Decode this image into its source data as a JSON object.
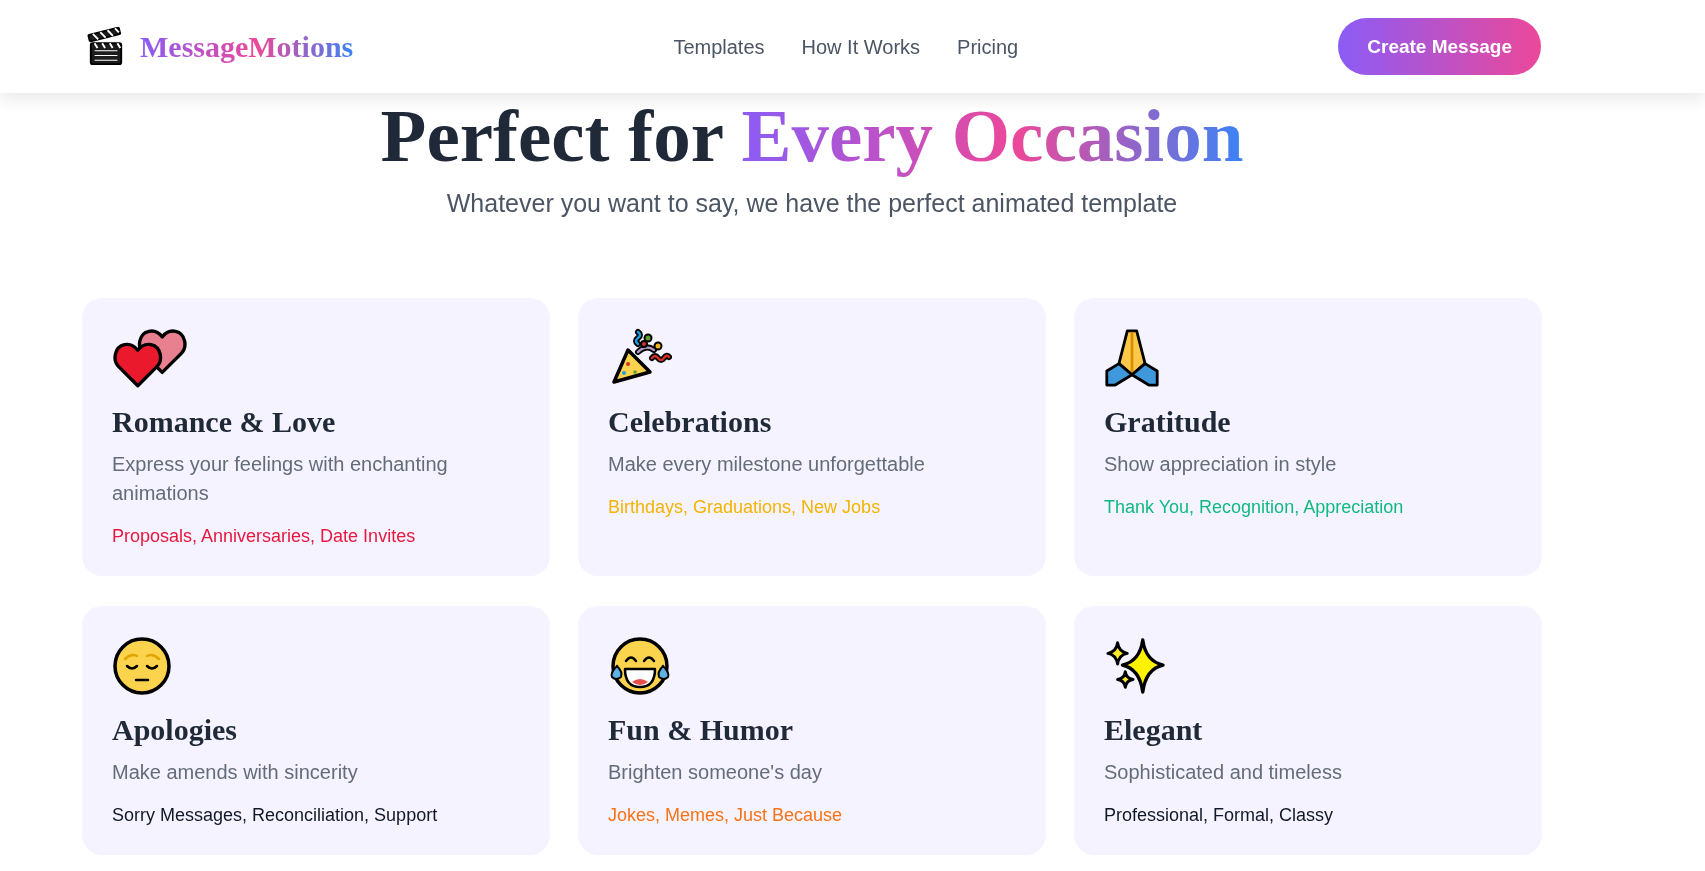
{
  "header": {
    "logo": "MessageMotions",
    "nav": [
      "Templates",
      "How It Works",
      "Pricing"
    ],
    "cta": "Create Message"
  },
  "hero": {
    "title": "Perfect for",
    "title_highlight": "Every Occasion",
    "subtitle": "Whatever you want to say, we have the perfect animated template"
  },
  "cards": [
    {
      "title": "Romance & Love",
      "description": "Express your feelings with enchanting animations",
      "tags": "Proposals, Anniversaries, Date Invites",
      "color": "#e8173f"
    },
    {
      "title": "Celebrations",
      "description": "Make every milestone unforgettable",
      "tags": "Birthdays, Graduations, New Jobs",
      "color": "#f4b400"
    },
    {
      "title": "Gratitude",
      "description": "Show appreciation in style",
      "tags": "Thank You, Recognition, Appreciation",
      "color": "#10b981"
    },
    {
      "title": "Apologies",
      "description": "Make amends with sincerity",
      "tags": "Sorry Messages, Reconciliation, Support",
      "color": "#111827"
    },
    {
      "title": "Fun & Humor",
      "description": "Brighten someone's day",
      "tags": "Jokes, Memes, Just Because",
      "color": "#f97316"
    },
    {
      "title": "Elegant",
      "description": "Sophisticated and timeless",
      "tags": "Professional, Formal, Classy",
      "color": "#111827"
    }
  ]
}
